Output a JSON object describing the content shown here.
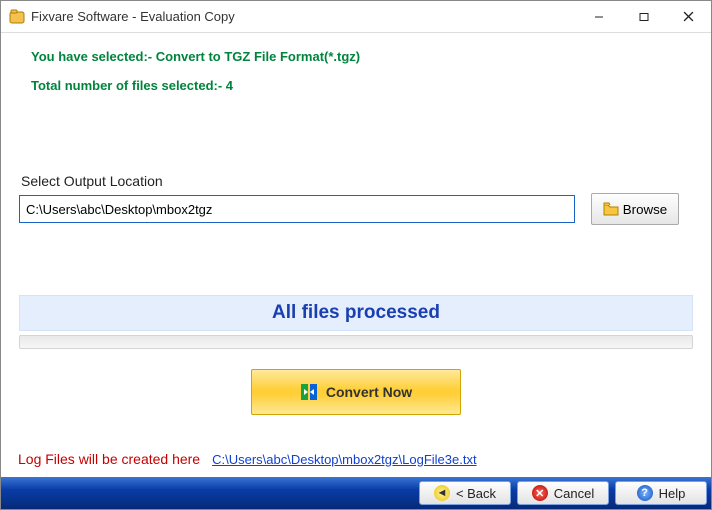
{
  "window": {
    "title": "Fixvare Software - Evaluation Copy"
  },
  "info": {
    "line1": "You have selected:- Convert to TGZ File Format(*.tgz)",
    "line2": "Total number of files selected:- 4"
  },
  "output": {
    "label": "Select Output Location",
    "path": "C:\\Users\\abc\\Desktop\\mbox2tgz",
    "browse_label": "Browse"
  },
  "status": {
    "text": "All files processed"
  },
  "convert": {
    "label": "Convert Now"
  },
  "log": {
    "label": "Log Files will be created here",
    "path_text": "C:\\Users\\abc\\Desktop\\mbox2tgz\\LogFile3e.txt"
  },
  "bottom": {
    "back": "< Back",
    "cancel": "Cancel",
    "help": "Help"
  }
}
